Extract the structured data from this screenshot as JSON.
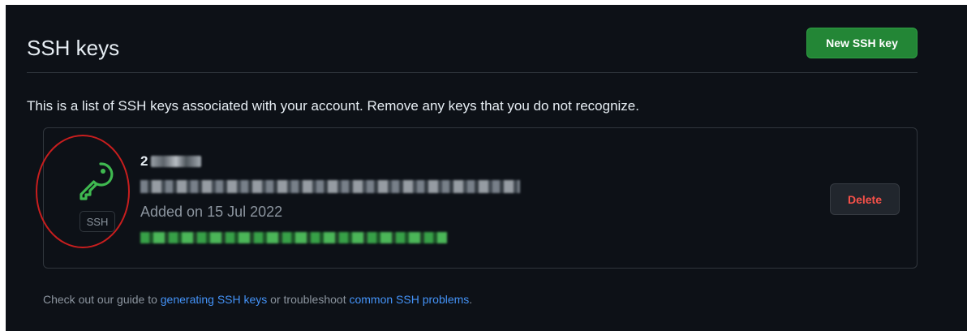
{
  "header": {
    "title": "SSH keys",
    "new_key_label": "New SSH key"
  },
  "description": "This is a list of SSH keys associated with your account. Remove any keys that you do not recognize.",
  "keys": [
    {
      "title_visible": "2",
      "type_badge": "SSH",
      "icon": "key-icon",
      "added_on": "Added on 15 Jul 2022",
      "delete_label": "Delete"
    }
  ],
  "footer": {
    "prefix": "Check out our guide to ",
    "link1": "generating SSH keys",
    "middle": " or troubleshoot ",
    "link2": "common SSH problems",
    "suffix": "."
  },
  "colors": {
    "background": "#0d1117",
    "primary_button": "#238636",
    "danger_text": "#f85149",
    "link": "#4493f8",
    "key_icon": "#3fb950",
    "annotation": "#c81e1e"
  }
}
